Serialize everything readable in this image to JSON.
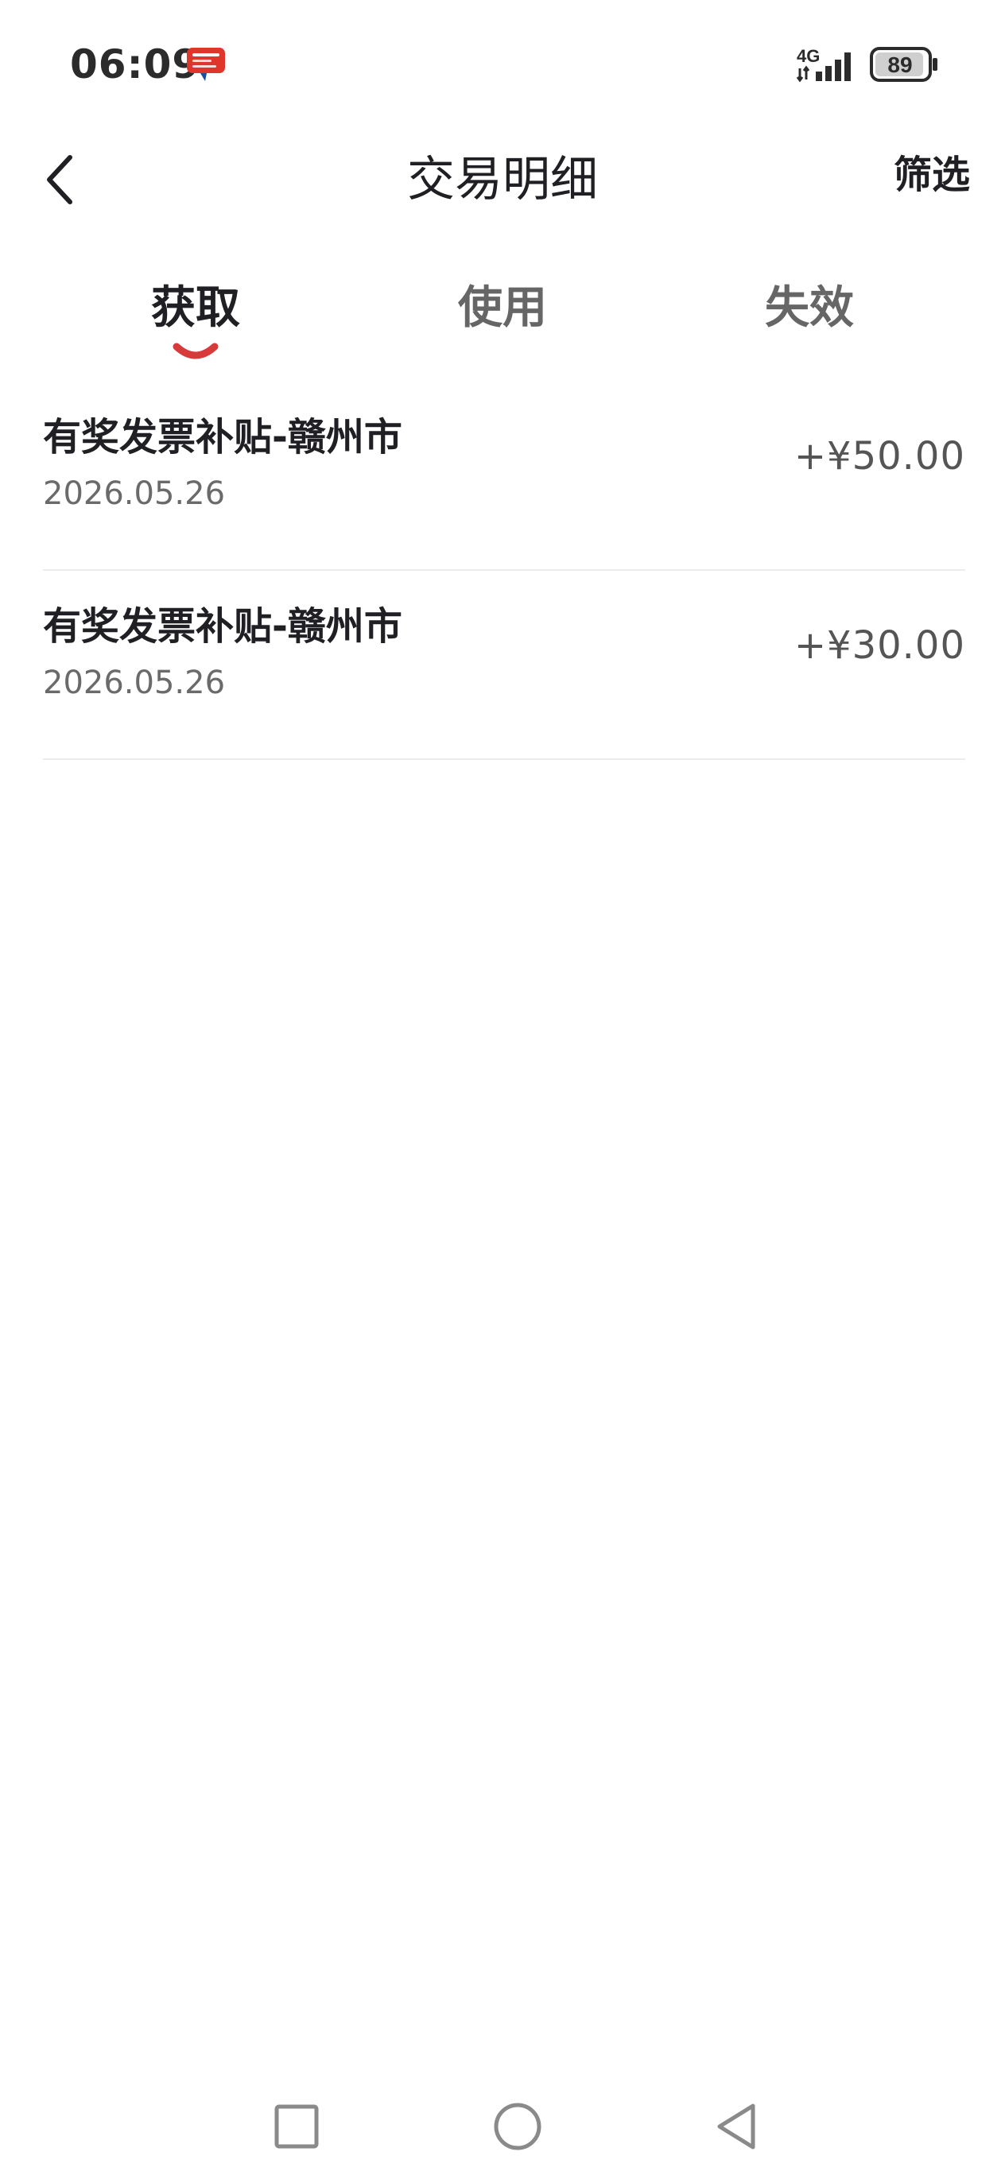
{
  "status_bar": {
    "time": "06:09",
    "app_badge_icon": "cloud-pay-badge-icon",
    "network": "4G",
    "battery_level": "89"
  },
  "header": {
    "back_icon": "chevron-left-icon",
    "title": "交易明细",
    "filter_label": "筛选"
  },
  "tabs": [
    {
      "label": "获取",
      "active": true
    },
    {
      "label": "使用",
      "active": false
    },
    {
      "label": "失效",
      "active": false
    }
  ],
  "transactions": [
    {
      "title": "有奖发票补贴-赣州市",
      "date": "2026.05.26",
      "amount": "+¥50.00"
    },
    {
      "title": "有奖发票补贴-赣州市",
      "date": "2026.05.26",
      "amount": "+¥30.00"
    }
  ],
  "nav_bar": {
    "recents_icon": "square-icon",
    "home_icon": "circle-icon",
    "back_icon": "triangle-back-icon"
  },
  "colors": {
    "accent": "#d83a3a",
    "text_primary": "#1f1f24",
    "text_secondary": "#6a6a6a",
    "divider": "#ececec"
  }
}
